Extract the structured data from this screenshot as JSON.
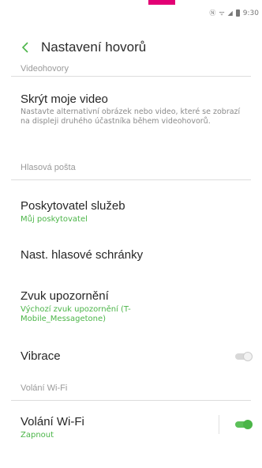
{
  "status_bar": {
    "time": "9:30"
  },
  "app_bar": {
    "title": "Nastavení hovorů"
  },
  "sections": {
    "video_calls": "Videohovory",
    "voicemail": "Hlasová pošta",
    "wifi_calls": "Volání Wi-Fi"
  },
  "items": {
    "hide_video": {
      "title": "Skrýt moje video",
      "description": "Nastavte alternativní obrázek nebo video, které se zobrazí na displeji druhého účastníka během videohovorů."
    },
    "service_provider": {
      "title": "Poskytovatel služeb",
      "subtitle": "Můj poskytovatel"
    },
    "voicemail_settings": {
      "title": "Nast. hlasové schránky"
    },
    "notification_sound": {
      "title": "Zvuk upozornění",
      "subtitle": "Výchozí zvuk upozornění (T-Mobile_Messagetone)"
    },
    "vibration": {
      "title": "Vibrace",
      "toggle_on": false
    },
    "wifi_calling": {
      "title": "Volání Wi-Fi",
      "subtitle": "Zapnout",
      "toggle_on": true
    }
  },
  "colors": {
    "accent_green": "#4bb548",
    "brand_magenta": "#e20074"
  },
  "icons": {
    "back": "chevron-left-icon",
    "signal": "signal-icon",
    "battery": "battery-icon",
    "nfc": "nfc-icon"
  }
}
